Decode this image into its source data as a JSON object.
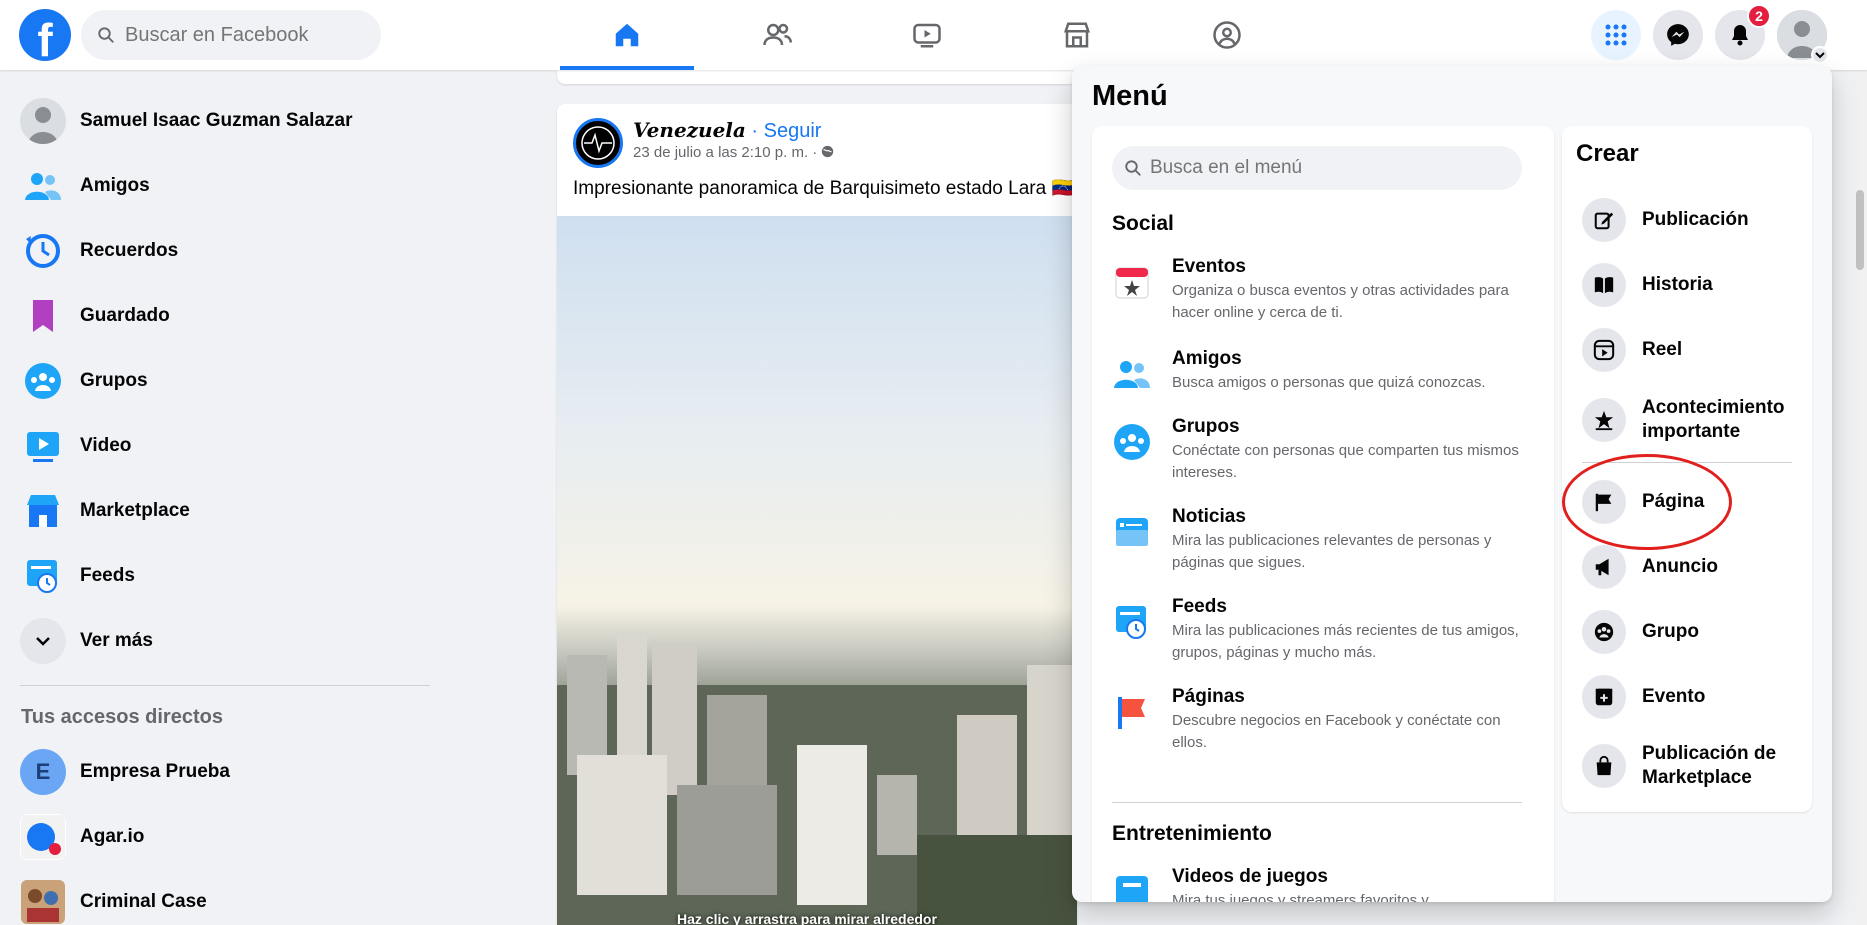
{
  "header": {
    "search_placeholder": "Buscar en Facebook",
    "notification_count": "2",
    "brand_color": "#1877f2"
  },
  "sidebar": {
    "items": [
      {
        "label": "Samuel Isaac Guzman Salazar",
        "icon": "profile-avatar"
      },
      {
        "label": "Amigos",
        "icon": "friends-icon"
      },
      {
        "label": "Recuerdos",
        "icon": "memories-icon"
      },
      {
        "label": "Guardado",
        "icon": "saved-icon"
      },
      {
        "label": "Grupos",
        "icon": "groups-icon"
      },
      {
        "label": "Video",
        "icon": "video-icon"
      },
      {
        "label": "Marketplace",
        "icon": "marketplace-icon"
      },
      {
        "label": "Feeds",
        "icon": "feeds-icon"
      },
      {
        "label": "Ver más",
        "icon": "chevron-down-icon"
      }
    ],
    "shortcuts_title": "Tus accesos directos",
    "shortcuts": [
      {
        "label": "Empresa Prueba",
        "initial": "E"
      },
      {
        "label": "Agar.io"
      },
      {
        "label": "Criminal Case"
      }
    ]
  },
  "post": {
    "author": "Venezuela",
    "separator": " · ",
    "follow": "Seguir",
    "meta": "23 de julio a las 2:10 p. m. · ",
    "text": "Impresionante panoramica de Barquisimeto estado Lara 🇻🇪",
    "photo_caption": "Haz clic y arrastra para mirar alrededor"
  },
  "menu": {
    "title": "Menú",
    "search_placeholder": "Busca en el menú",
    "social_title": "Social",
    "social_items": [
      {
        "title": "Eventos",
        "desc": "Organiza o busca eventos y otras actividades para hacer online y cerca de ti."
      },
      {
        "title": "Amigos",
        "desc": "Busca amigos o personas que quizá conozcas."
      },
      {
        "title": "Grupos",
        "desc": "Conéctate con personas que comparten tus mismos intereses."
      },
      {
        "title": "Noticias",
        "desc": "Mira las publicaciones relevantes de personas y páginas que sigues."
      },
      {
        "title": "Feeds",
        "desc": "Mira las publicaciones más recientes de tus amigos, grupos, páginas y mucho más."
      },
      {
        "title": "Páginas",
        "desc": "Descubre negocios en Facebook y conéctate con ellos."
      }
    ],
    "entertainment_title": "Entretenimiento",
    "entertainment_items": [
      {
        "title": "Videos de juegos",
        "desc": "Mira tus juegos y streamers favoritos y..."
      }
    ],
    "create_title": "Crear",
    "create_items": [
      {
        "label": "Publicación",
        "icon": "edit-icon"
      },
      {
        "label": "Historia",
        "icon": "book-icon"
      },
      {
        "label": "Reel",
        "icon": "reel-icon"
      },
      {
        "label": "Acontecimiento importante",
        "icon": "star-icon"
      },
      {
        "label": "Página",
        "icon": "flag-icon"
      },
      {
        "label": "Anuncio",
        "icon": "megaphone-icon"
      },
      {
        "label": "Grupo",
        "icon": "group-icon"
      },
      {
        "label": "Evento",
        "icon": "event-icon"
      },
      {
        "label": "Publicación de Marketplace",
        "icon": "shopping-bag-icon"
      }
    ]
  }
}
